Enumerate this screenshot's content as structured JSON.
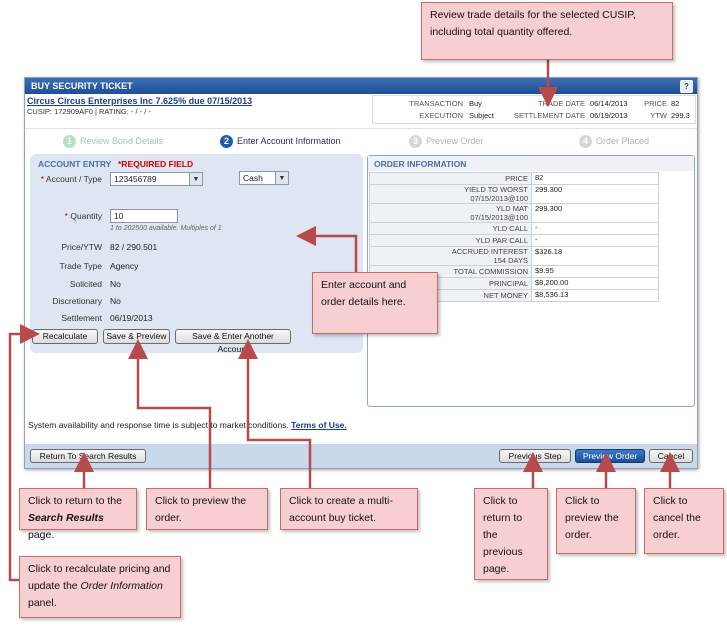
{
  "window": {
    "title": "BUY SECURITY TICKET",
    "help_label": "?",
    "security_name": "Circus Circus Enterprises Inc 7.625% due 07/15/2013",
    "security_meta": "CUSIP: 172909AF0 | RATING: - / - / -"
  },
  "trade_summary": {
    "transaction_label": "TRANSACTION",
    "transaction_value": "Buy",
    "execution_label": "EXECUTION",
    "execution_value": "Subject",
    "trade_date_label": "TRADE DATE",
    "trade_date_value": "06/14/2013",
    "settlement_date_label": "SETTLEMENT DATE",
    "settlement_date_value": "06/19/2013",
    "price_label": "PRICE",
    "price_value": "82",
    "ytw_label": "YTW",
    "ytw_value": "299.3"
  },
  "steps": [
    {
      "num": "1",
      "label": "Review Bond Details",
      "state": "done"
    },
    {
      "num": "2",
      "label": "Enter Account Information",
      "state": "active"
    },
    {
      "num": "3",
      "label": "Preview Order",
      "state": "pending"
    },
    {
      "num": "4",
      "label": "Order Placed",
      "state": "pending"
    }
  ],
  "account_entry": {
    "heading": "ACCOUNT ENTRY",
    "required_note": "*REQUIRED FIELD",
    "account_label": "Account / Type",
    "account_value": "123456789",
    "type_value": "Cash",
    "quantity_label": "Quantity",
    "quantity_value": "10",
    "quantity_hint": "1 to 202500 available. Multiples of 1",
    "price_ytw_label": "Price/YTW",
    "price_ytw_value": "82 / 290.501",
    "trade_type_label": "Trade Type",
    "trade_type_value": "Agency",
    "solicited_label": "Solicited",
    "solicited_value": "No",
    "discretionary_label": "Discretionary",
    "discretionary_value": "No",
    "settlement_label": "Settlement",
    "settlement_value": "06/19/2013",
    "recalculate_label": "Recalculate",
    "save_preview_label": "Save & Preview",
    "save_another_label": "Save & Enter Another Account"
  },
  "order_information": {
    "heading": "ORDER INFORMATION",
    "rows": [
      {
        "key": "PRICE",
        "key2": "",
        "value": "82"
      },
      {
        "key": "YIELD TO WORST",
        "key2": "07/15/2013@100",
        "value": "299.300"
      },
      {
        "key": "YLD MAT",
        "key2": "07/15/2013@100",
        "value": "299.300"
      },
      {
        "key": "YLD CALL",
        "key2": "",
        "value": "-"
      },
      {
        "key": "YLD PAR CALL",
        "key2": "",
        "value": "-"
      },
      {
        "key": "ACCRUED INTEREST",
        "key2": "154 DAYS",
        "value": "$326.18"
      },
      {
        "key": "TOTAL COMMISSION",
        "key2": "",
        "value": "$9.95"
      },
      {
        "key": "PRINCIPAL",
        "key2": "",
        "value": "$8,200.00"
      },
      {
        "key": "NET MONEY",
        "key2": "",
        "value": "$8,536.13"
      }
    ]
  },
  "footer": {
    "disclaimer": "System availability and response time is subject to market conditions.",
    "terms_link": "Terms of Use.",
    "return_label": "Return To Search Results",
    "previous_label": "Previous Step",
    "preview_label": "Preview Order",
    "cancel_label": "Cancel"
  },
  "callouts": {
    "trade_details": "Review trade details for the selected CUSIP, including total quantity offered.",
    "enter_details": "Enter account and order details here.",
    "return_search_pre": "Click to return to the ",
    "return_search_em": "Search Results",
    "return_search_post": " page.",
    "preview_order": "Click to preview the order.",
    "multi_account": "Click to create a multi-account buy ticket.",
    "previous_page": "Click to return to the previous page.",
    "preview_order_2": "Click to preview the order.",
    "cancel_order": "Click to cancel the order.",
    "recalc_pre": "Click to recalculate pricing and update the ",
    "recalc_em": "Order Information",
    "recalc_post": " panel."
  },
  "colors": {
    "callout_fill": "#f8cfd0",
    "callout_border": "#c76b6c",
    "arrow": "#b84a4b",
    "title_bar": "#1e4f95",
    "panel": "#dde6f2"
  }
}
